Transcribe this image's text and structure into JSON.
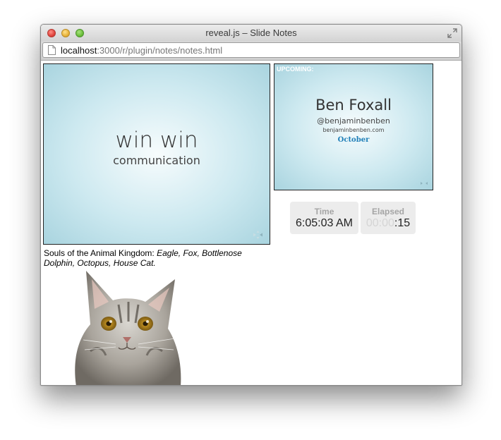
{
  "window": {
    "title": "reveal.js – Slide Notes"
  },
  "urlbar": {
    "host": "localhost",
    "path": ":3000/r/plugin/notes/notes.html"
  },
  "current_slide": {
    "title": "win win",
    "subtitle": "communication"
  },
  "upcoming_slide": {
    "label": "UPCOMING:",
    "name": "Ben Foxall",
    "handle": "@benjaminbenben",
    "site": "benjaminbenben.com",
    "logo_text": "October"
  },
  "timers": {
    "time_label": "Time",
    "time_value": "6:05:03 AM",
    "elapsed_label": "Elapsed",
    "elapsed_dim": "00:00",
    "elapsed_value": ":15"
  },
  "notes": {
    "prefix": "Souls of the Animal Kingdom: ",
    "italic": "Eagle, Fox, Bottlenose Dolphin, Octopus, House Cat."
  }
}
